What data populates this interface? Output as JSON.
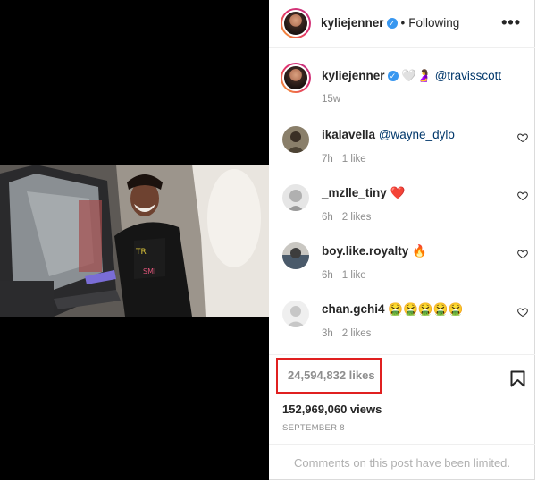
{
  "post": {
    "author": "kyliejenner",
    "follow_status": "Following",
    "more_label": "•••",
    "verified_icon": "verified-badge-icon",
    "accent": "#3897f0"
  },
  "caption": {
    "author": "kyliejenner",
    "emoji": "🤍🤰",
    "mention": "@travisscott",
    "time": "15w"
  },
  "comments": [
    {
      "username": "ikalavella",
      "text": "@wayne_dylo",
      "time": "7h",
      "likes": "1 like"
    },
    {
      "username": "_mzlle_tiny",
      "text": "❤️",
      "time": "6h",
      "likes": "2 likes"
    },
    {
      "username": "boy.like.royalty",
      "text": "🔥",
      "time": "6h",
      "likes": "1 like"
    },
    {
      "username": "chan.gchi4",
      "text": "🤮🤮🤮🤮🤮",
      "time": "3h",
      "likes": "2 likes"
    }
  ],
  "stats": {
    "likes": "24,594,832 likes",
    "views": "152,969,060 views",
    "date": "SEPTEMBER 8",
    "highlight_color": "#e02020"
  },
  "footer": {
    "notice": "Comments on this post have been limited."
  }
}
